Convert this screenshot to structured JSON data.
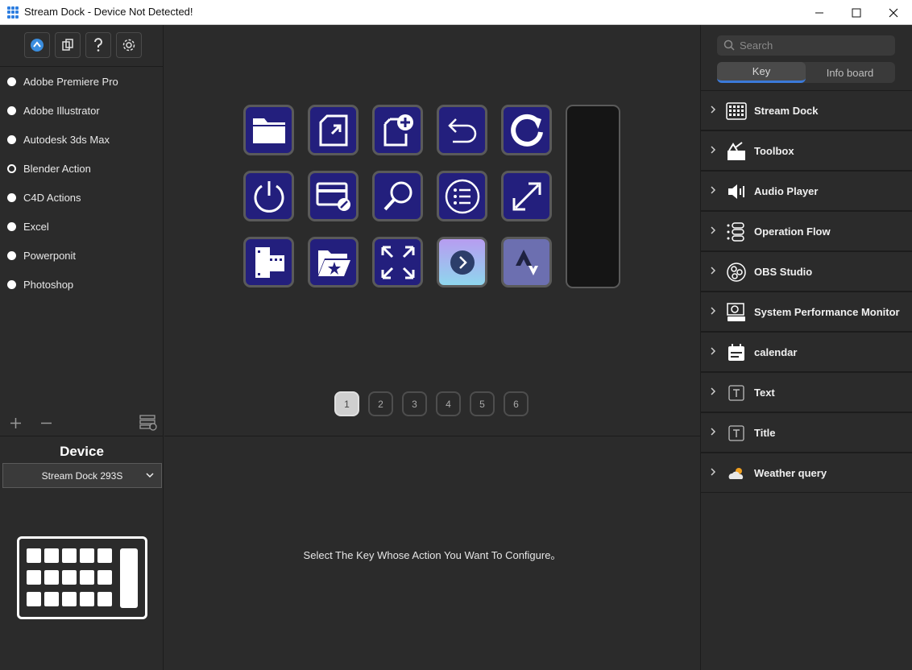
{
  "window": {
    "title": "Stream Dock - Device Not Detected!"
  },
  "profiles": [
    {
      "name": "Adobe Premiere Pro",
      "selected": false
    },
    {
      "name": "Adobe Illustrator",
      "selected": false
    },
    {
      "name": "Autodesk 3ds Max",
      "selected": false
    },
    {
      "name": "Blender  Action",
      "selected": true
    },
    {
      "name": "C4D Actions",
      "selected": false
    },
    {
      "name": "Excel",
      "selected": false
    },
    {
      "name": "Powerponit",
      "selected": false
    },
    {
      "name": "Photoshop",
      "selected": false
    }
  ],
  "device": {
    "label": "Device",
    "selected": "Stream Dock 293S"
  },
  "keys": [
    {
      "icon": "folder-icon"
    },
    {
      "icon": "file-import-icon"
    },
    {
      "icon": "new-file-icon"
    },
    {
      "icon": "undo-icon"
    },
    {
      "icon": "redo-icon"
    },
    {
      "icon": "power-icon"
    },
    {
      "icon": "card-edit-icon"
    },
    {
      "icon": "magnifier-icon"
    },
    {
      "icon": "list-icon"
    },
    {
      "icon": "resize-diagonal-icon"
    },
    {
      "icon": "film-icon"
    },
    {
      "icon": "favorite-folder-icon"
    },
    {
      "icon": "fullscreen-icon"
    },
    {
      "icon": "next-circle-icon"
    },
    {
      "icon": "strava-icon"
    }
  ],
  "pages": [
    "1",
    "2",
    "3",
    "4",
    "5",
    "6"
  ],
  "active_page": "1",
  "hint": "Select The Key Whose Action You Want To Configure。",
  "search": {
    "placeholder": "Search"
  },
  "tabs": [
    {
      "label": "Key",
      "active": true
    },
    {
      "label": "Info board",
      "active": false
    }
  ],
  "categories": [
    {
      "label": "Stream Dock",
      "icon": "stream-dock-icon"
    },
    {
      "label": "Toolbox",
      "icon": "toolbox-icon"
    },
    {
      "label": "Audio Player",
      "icon": "speaker-icon"
    },
    {
      "label": "Operation Flow",
      "icon": "flow-icon"
    },
    {
      "label": "OBS Studio",
      "icon": "obs-icon"
    },
    {
      "label": "System Performance Monitor",
      "icon": "monitor-icon"
    },
    {
      "label": "calendar",
      "icon": "calendar-icon"
    },
    {
      "label": "Text",
      "icon": "text-icon"
    },
    {
      "label": "Title",
      "icon": "title-icon"
    },
    {
      "label": "Weather query",
      "icon": "weather-icon"
    }
  ],
  "colors": {
    "key_bg": "#231f7d",
    "accent": "#3b7ad9",
    "panel_bg": "#2b2b2b"
  }
}
